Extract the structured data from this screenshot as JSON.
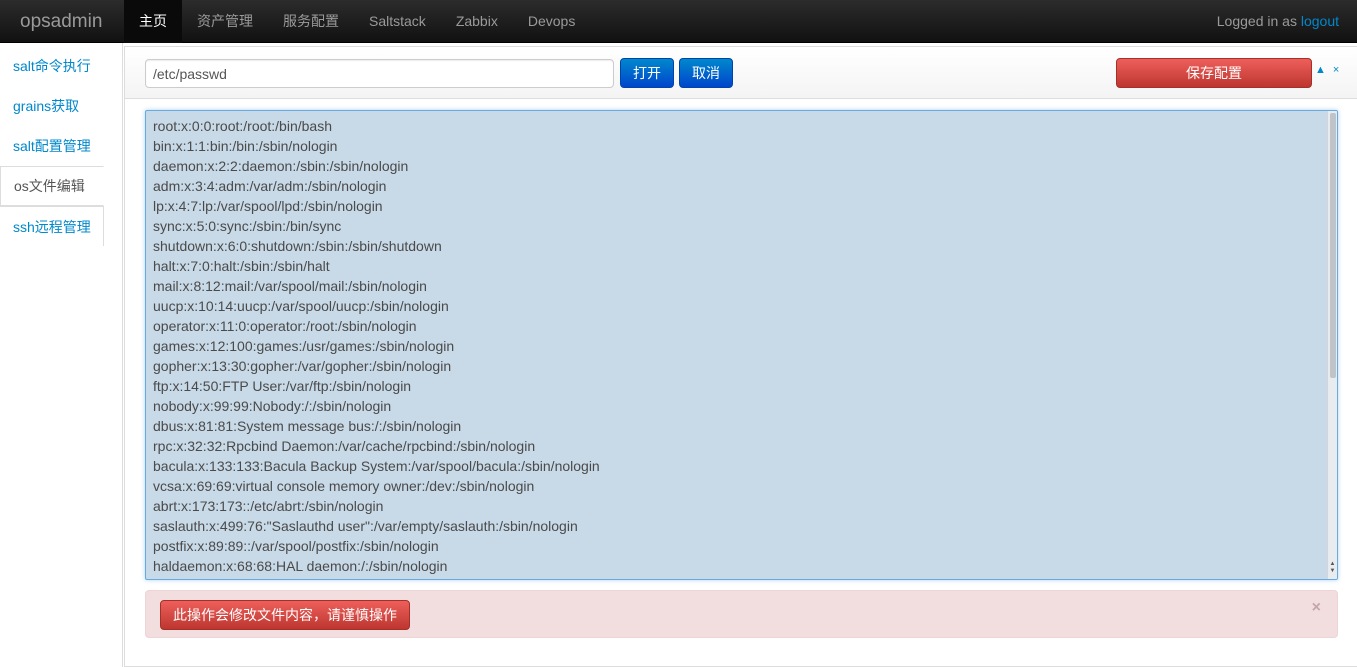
{
  "navbar": {
    "brand": "opsadmin",
    "items": [
      "主页",
      "资产管理",
      "服务配置",
      "Saltstack",
      "Zabbix",
      "Devops"
    ],
    "login_text": "Logged in as ",
    "logout_label": "logout"
  },
  "sidebar": {
    "items": [
      "salt命令执行",
      "grains获取",
      "salt配置管理",
      "os文件编辑",
      "ssh远程管理"
    ],
    "active_index": 3
  },
  "toolbar": {
    "path_value": "/etc/passwd",
    "open_label": "打开",
    "cancel_label": "取消",
    "save_label": "保存配置",
    "collapse_icon": "▲",
    "close_icon": "×"
  },
  "editor": {
    "lines": [
      "root:x:0:0:root:/root:/bin/bash",
      "bin:x:1:1:bin:/bin:/sbin/nologin",
      "daemon:x:2:2:daemon:/sbin:/sbin/nologin",
      "adm:x:3:4:adm:/var/adm:/sbin/nologin",
      "lp:x:4:7:lp:/var/spool/lpd:/sbin/nologin",
      "sync:x:5:0:sync:/sbin:/bin/sync",
      "shutdown:x:6:0:shutdown:/sbin:/sbin/shutdown",
      "halt:x:7:0:halt:/sbin:/sbin/halt",
      "mail:x:8:12:mail:/var/spool/mail:/sbin/nologin",
      "uucp:x:10:14:uucp:/var/spool/uucp:/sbin/nologin",
      "operator:x:11:0:operator:/root:/sbin/nologin",
      "games:x:12:100:games:/usr/games:/sbin/nologin",
      "gopher:x:13:30:gopher:/var/gopher:/sbin/nologin",
      "ftp:x:14:50:FTP User:/var/ftp:/sbin/nologin",
      "nobody:x:99:99:Nobody:/:/sbin/nologin",
      "dbus:x:81:81:System message bus:/:/sbin/nologin",
      "rpc:x:32:32:Rpcbind Daemon:/var/cache/rpcbind:/sbin/nologin",
      "bacula:x:133:133:Bacula Backup System:/var/spool/bacula:/sbin/nologin",
      "vcsa:x:69:69:virtual console memory owner:/dev:/sbin/nologin",
      "abrt:x:173:173::/etc/abrt:/sbin/nologin",
      "saslauth:x:499:76:\"Saslauthd user\":/var/empty/saslauth:/sbin/nologin",
      "postfix:x:89:89::/var/spool/postfix:/sbin/nologin",
      "haldaemon:x:68:68:HAL daemon:/:/sbin/nologin"
    ]
  },
  "alert": {
    "button_label": "此操作会修改文件内容，请谨慎操作",
    "close_icon": "×"
  }
}
